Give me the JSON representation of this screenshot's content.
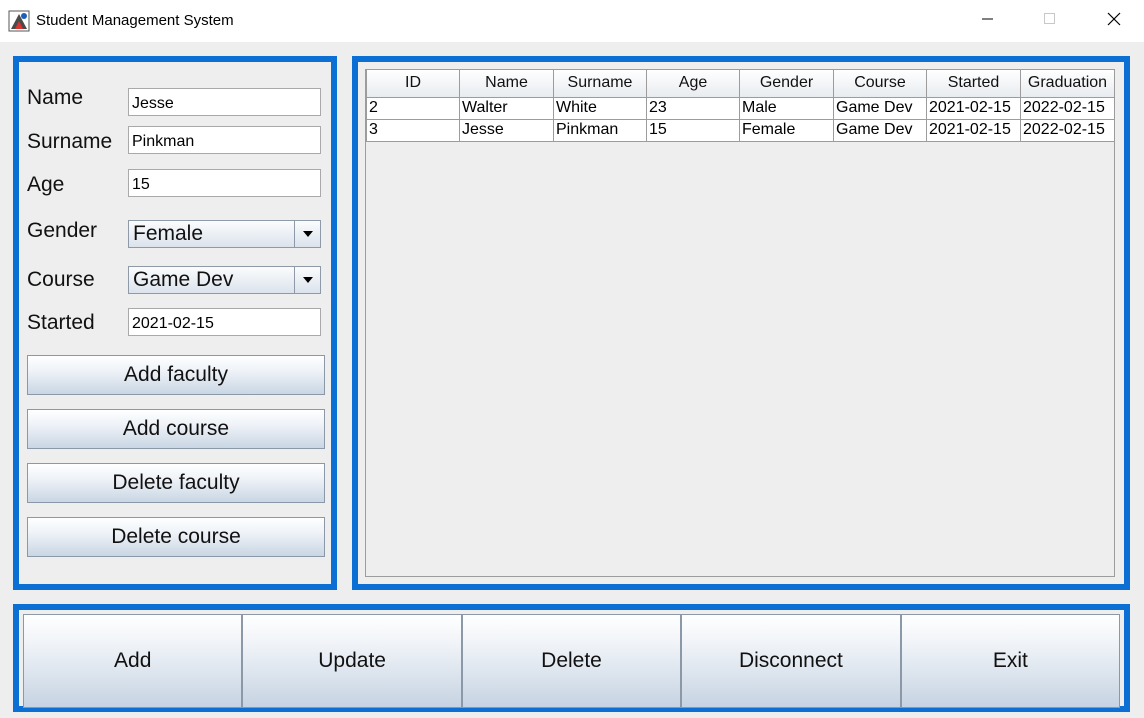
{
  "window": {
    "title": "Student Management System",
    "icon": "java-app-icon",
    "controls": [
      "minimize-icon",
      "maximize-icon",
      "close-icon"
    ]
  },
  "form": {
    "labels": {
      "name": "Name",
      "surname": "Surname",
      "age": "Age",
      "gender": "Gender",
      "course": "Course",
      "started": "Started"
    },
    "values": {
      "name": "Jesse",
      "surname": "Pinkman",
      "age": "15",
      "gender": "Female",
      "course": "Game Dev",
      "started": "2021-02-15"
    }
  },
  "side_buttons": {
    "add_faculty": "Add faculty",
    "add_course": "Add course",
    "delete_faculty": "Delete faculty",
    "delete_course": "Delete course"
  },
  "table": {
    "columns": [
      "ID",
      "Name",
      "Surname",
      "Age",
      "Gender",
      "Course",
      "Started",
      "Graduation"
    ],
    "rows": [
      [
        "2",
        "Walter",
        "White",
        "23",
        "Male",
        "Game Dev",
        "2021-02-15",
        "2022-02-15"
      ],
      [
        "3",
        "Jesse",
        "Pinkman",
        "15",
        "Female",
        "Game Dev",
        "2021-02-15",
        "2022-02-15"
      ]
    ]
  },
  "bottom_buttons": {
    "add": "Add",
    "update": "Update",
    "delete": "Delete",
    "disconnect": "Disconnect",
    "exit": "Exit"
  },
  "colors": {
    "panel_border": "#0b6fd3",
    "background": "#eeeeee"
  }
}
